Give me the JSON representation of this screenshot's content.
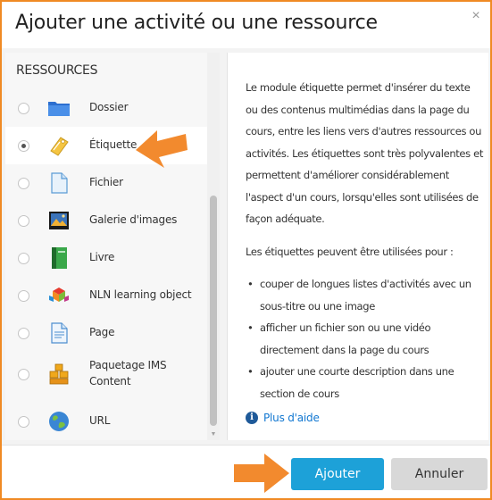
{
  "dialog": {
    "title": "Ajouter une activité ou une ressource",
    "close_symbol": "×"
  },
  "left_pane": {
    "section_title": "RESSOURCES",
    "items": [
      {
        "label": "Dossier",
        "icon": "folder-icon",
        "selected": false
      },
      {
        "label": "Étiquette",
        "icon": "label-tag-icon",
        "selected": true
      },
      {
        "label": "Fichier",
        "icon": "file-icon",
        "selected": false
      },
      {
        "label": "Galerie d'images",
        "icon": "image-gallery-icon",
        "selected": false
      },
      {
        "label": "Livre",
        "icon": "book-icon",
        "selected": false
      },
      {
        "label": "NLN learning object",
        "icon": "nln-object-icon",
        "selected": false
      },
      {
        "label": "Page",
        "icon": "page-icon",
        "selected": false
      },
      {
        "label": "Paquetage IMS Content",
        "icon": "ims-package-icon",
        "selected": false
      },
      {
        "label": "URL",
        "icon": "url-globe-icon",
        "selected": false
      }
    ]
  },
  "right_pane": {
    "paragraph_1": "Le module étiquette permet d'insérer du texte ou des contenus multimédias dans la page du cours, entre les liens vers d'autres ressources ou activités. Les étiquettes sont très polyvalentes et permettent d'améliorer considérablement l'aspect d'un cours, lorsqu'elles sont utilisées de façon adéquate.",
    "paragraph_2": "Les étiquettes peuvent être utilisées pour :",
    "bullets": [
      "couper de longues listes d'activités avec un sous-titre ou une image",
      "afficher un fichier son ou une vidéo directement dans la page du cours",
      "ajouter une courte description dans une section de cours"
    ],
    "help_link": "Plus d'aide"
  },
  "footer": {
    "add_label": "Ajouter",
    "cancel_label": "Annuler"
  },
  "colors": {
    "accent_border": "#f08a24",
    "arrow": "#f28a2e",
    "primary_button": "#1da1d8",
    "link": "#1177d1"
  }
}
